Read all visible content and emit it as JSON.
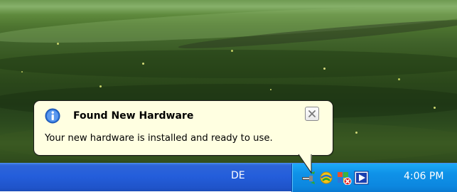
{
  "balloon": {
    "title": "Found New Hardware",
    "message": "Your new hardware is installed and ready to use.",
    "icon": "info-icon",
    "close_icon": "close-icon"
  },
  "taskbar": {
    "language": "DE",
    "tray_icons": [
      "safely-remove-hardware-icon",
      "network-connection-icon",
      "security-center-alert-icon",
      "media-player-icon"
    ],
    "clock": "4:06 PM"
  },
  "colors": {
    "balloon_background": "#ffffe1",
    "taskbar_blue": "#245edb",
    "tray_blue": "#0f92e8",
    "info_blue": "#2a6fd6"
  }
}
